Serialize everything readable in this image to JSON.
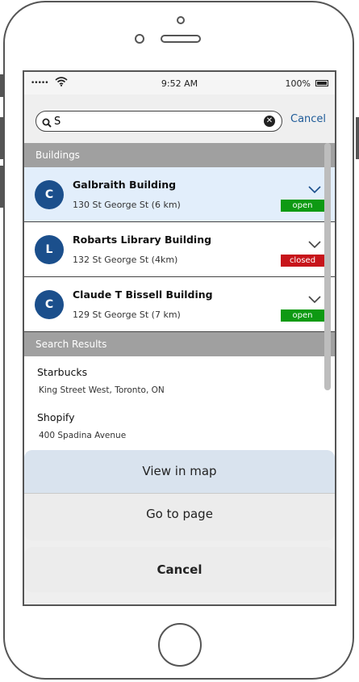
{
  "status_bar": {
    "signal": "•••••",
    "time": "9:52 AM",
    "battery": "100%"
  },
  "search": {
    "value": "S",
    "placeholder": "",
    "cancel_label": "Cancel"
  },
  "buildings_section": {
    "title": "Buildings",
    "items": [
      {
        "initial": "C",
        "name": "Galbraith Building",
        "address": "130 St George St (6 km)",
        "status": "open"
      },
      {
        "initial": "L",
        "name": "Robarts Library Building",
        "address": "132 St George St (4km)",
        "status": "closed"
      },
      {
        "initial": "C",
        "name": "Claude T Bissell Building",
        "address": "129 St George St (7 km)",
        "status": "open"
      }
    ]
  },
  "results_section": {
    "title": "Search Results",
    "items": [
      {
        "name": "Starbucks",
        "subtitle": "King Street West, Toronto, ON"
      },
      {
        "name": "Shopify",
        "subtitle": "400 Spadina Avenue"
      }
    ]
  },
  "action_sheet": {
    "view_in_map": "View in map",
    "go_to_page": "Go to page",
    "cancel": "Cancel"
  },
  "colors": {
    "accent": "#1b4f8c",
    "open": "#0e9a13",
    "closed": "#c7141a",
    "selected_row": "#e2eefb"
  }
}
